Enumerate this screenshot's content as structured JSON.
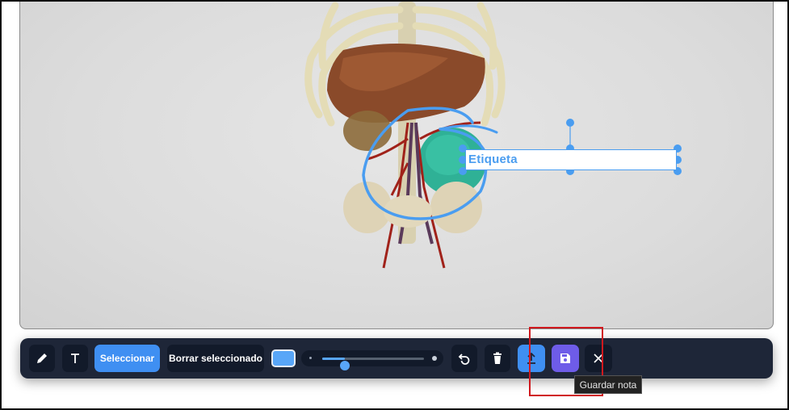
{
  "canvas": {
    "label_text": "Etiqueta"
  },
  "toolbar": {
    "pen_icon": "pencil-icon",
    "text_icon": "text-tool-icon",
    "select_label": "Seleccionar",
    "delete_selected_label": "Borrar seleccionado",
    "color_value": "#58a6f8",
    "brush_size_fraction": 0.22,
    "undo_icon": "undo-icon",
    "trash_icon": "trash-icon",
    "upload_icon": "upload-icon",
    "save_icon": "save-icon",
    "close_icon": "close-icon"
  },
  "tooltip": {
    "text": "Guardar nota"
  },
  "colors": {
    "accent_blue": "#3f8ff2",
    "save_purple": "#6e5ce8",
    "annotation_blue": "#4a9df0",
    "toolbar_bg": "#1e2638",
    "highlight_red": "#d0191e"
  }
}
